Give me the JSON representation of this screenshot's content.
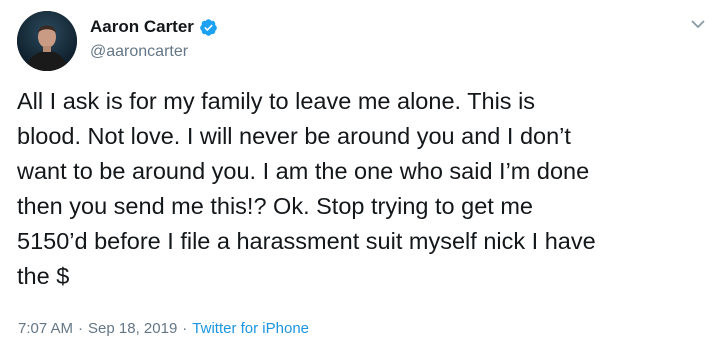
{
  "user": {
    "display_name": "Aaron Carter",
    "handle": "@aaroncarter"
  },
  "icons": {
    "verified": "verified-badge-icon",
    "menu": "chevron-down-icon",
    "verified_color": "#1da1f2"
  },
  "tweet": {
    "text_lines": [
      "All I ask is for my family to leave me alone. This is",
      "blood. Not love. I will never be around you and I don’t",
      "want to be around you. I am the one who said I’m done",
      "then you send me this!? Ok. Stop trying to get me",
      "5150’d before I file a harassment suit myself nick I have",
      "the $"
    ]
  },
  "meta": {
    "time": "7:07 AM",
    "separator": "·",
    "date": "Sep 18, 2019",
    "source": "Twitter for iPhone"
  },
  "colors": {
    "text": "#14171a",
    "secondary": "#657786",
    "link": "#1b95e0"
  }
}
